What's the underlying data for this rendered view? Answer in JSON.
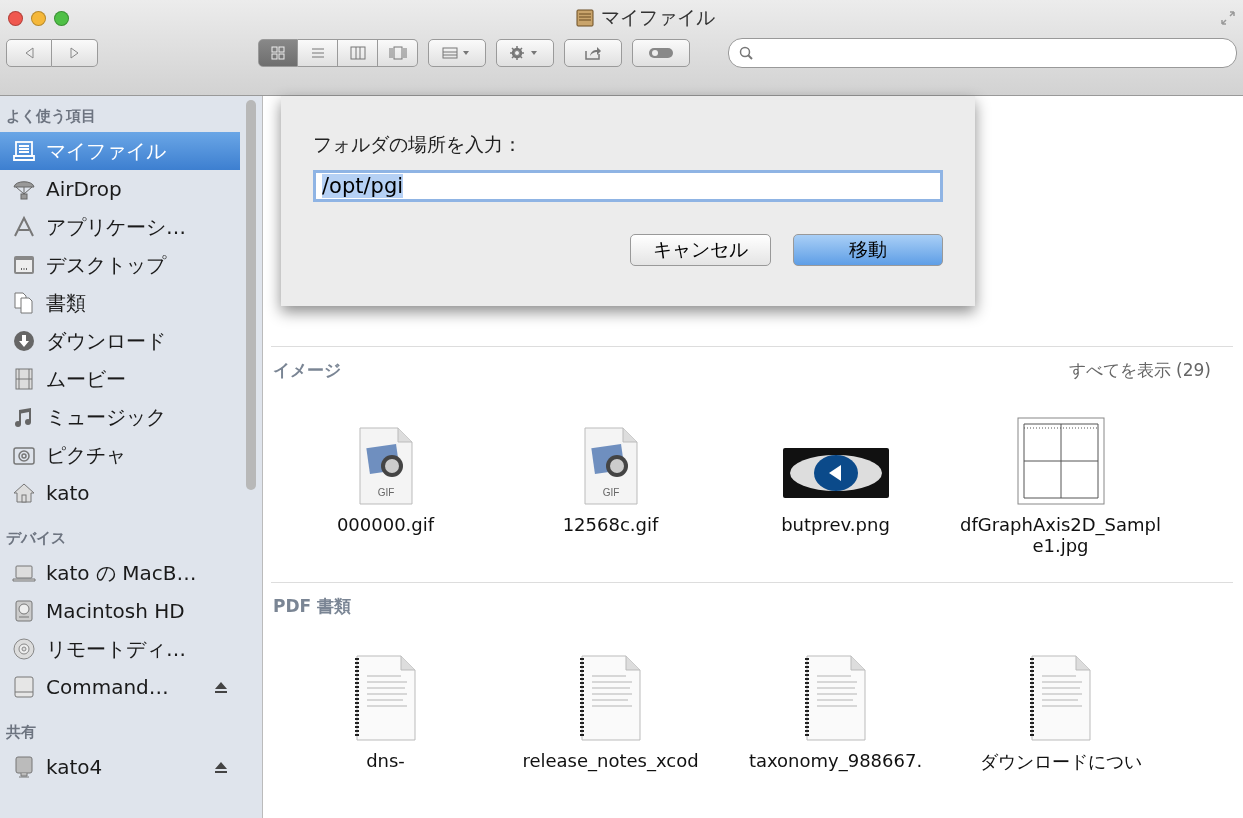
{
  "window": {
    "title": "マイファイル"
  },
  "toolbar": {
    "views": [
      {
        "kind": "icon",
        "selected": true
      },
      {
        "kind": "list",
        "selected": false
      },
      {
        "kind": "columns",
        "selected": false
      },
      {
        "kind": "coverflow",
        "selected": false
      }
    ]
  },
  "sidebar": {
    "sections": [
      {
        "title": "よく使う項目",
        "items": [
          {
            "label": "マイファイル",
            "selected": true,
            "eject": false
          },
          {
            "label": "AirDrop",
            "selected": false,
            "eject": false
          },
          {
            "label": "アプリケーシ…",
            "selected": false,
            "eject": false
          },
          {
            "label": "デスクトップ",
            "selected": false,
            "eject": false
          },
          {
            "label": "書類",
            "selected": false,
            "eject": false
          },
          {
            "label": "ダウンロード",
            "selected": false,
            "eject": false
          },
          {
            "label": "ムービー",
            "selected": false,
            "eject": false
          },
          {
            "label": "ミュージック",
            "selected": false,
            "eject": false
          },
          {
            "label": "ピクチャ",
            "selected": false,
            "eject": false
          },
          {
            "label": "kato",
            "selected": false,
            "eject": false
          }
        ]
      },
      {
        "title": "デバイス",
        "items": [
          {
            "label": "kato の MacB…",
            "selected": false,
            "eject": false
          },
          {
            "label": "Macintosh HD",
            "selected": false,
            "eject": false
          },
          {
            "label": "リモートディ…",
            "selected": false,
            "eject": false
          },
          {
            "label": "Command…",
            "selected": false,
            "eject": true
          }
        ]
      },
      {
        "title": "共有",
        "items": [
          {
            "label": "kato4",
            "selected": false,
            "eject": true
          }
        ]
      }
    ]
  },
  "dialog": {
    "prompt": "フォルダの場所を入力：",
    "value": "/opt/pgi",
    "buttons": [
      {
        "label": "キャンセル",
        "kind": "cancel"
      },
      {
        "label": "移動",
        "kind": "default"
      }
    ]
  },
  "sections": [
    {
      "title": "イメージ",
      "show_all": "すべてを表示 (29)",
      "files": [
        {
          "name": "000000.gif",
          "kind": "gif",
          "type_label": "GIF"
        },
        {
          "name": "12568c.gif",
          "kind": "gif",
          "type_label": "GIF"
        },
        {
          "name": "butprev.png",
          "kind": "png"
        },
        {
          "name": "dfGraphAxis2D_Sample1.jpg",
          "kind": "jpg"
        }
      ]
    },
    {
      "title": "PDF 書類",
      "files": [
        {
          "name": "dns-",
          "kind": "pdf"
        },
        {
          "name": "release_notes_xcod",
          "kind": "pdf"
        },
        {
          "name": "taxonomy_988667.",
          "kind": "pdf"
        },
        {
          "name": "ダウンロードについ",
          "kind": "pdf"
        }
      ]
    }
  ]
}
